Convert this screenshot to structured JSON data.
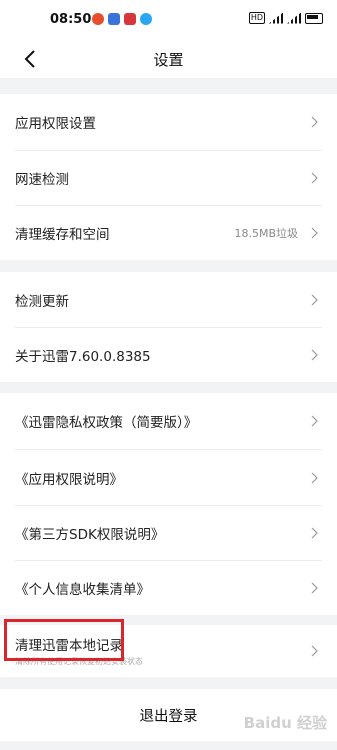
{
  "status_bar": {
    "time": "08:50",
    "network": "HD",
    "app_icons": [
      {
        "name": "orange-app-icon",
        "color": "#e84d2c"
      },
      {
        "name": "translate-app-icon",
        "color": "#3b74d8"
      },
      {
        "name": "red-app-icon",
        "color": "#d7373c"
      },
      {
        "name": "qq-app-icon",
        "color": "#2aa6f0"
      }
    ]
  },
  "header": {
    "title": "设置",
    "back_icon": "chevron-left-icon"
  },
  "groups": [
    {
      "items": [
        {
          "label": "应用权限设置",
          "value": ""
        },
        {
          "label": "网速检测",
          "value": ""
        },
        {
          "label": "清理缓存和空间",
          "value": "18.5MB垃圾"
        }
      ]
    },
    {
      "items": [
        {
          "label": "检测更新",
          "value": ""
        },
        {
          "label": "关于迅雷7.60.0.8385",
          "value": ""
        }
      ]
    },
    {
      "items": [
        {
          "label": "《迅雷隐私权政策（简要版）》",
          "value": ""
        },
        {
          "label": "《应用权限说明》",
          "value": ""
        },
        {
          "label": "《第三方SDK权限说明》",
          "value": ""
        },
        {
          "label": "《个人信息收集清单》",
          "value": ""
        }
      ]
    },
    {
      "items": [
        {
          "label": "清理迅雷本地记录",
          "value": "",
          "sub": "清除所有使用记录恢复初始安装状态"
        }
      ]
    }
  ],
  "logout_label": "退出登录",
  "watermark": "Baidu 经验",
  "colors": {
    "background": "#f2f3f5",
    "card": "#ffffff",
    "highlight": "#d9262c",
    "secondary_text": "#888888"
  }
}
